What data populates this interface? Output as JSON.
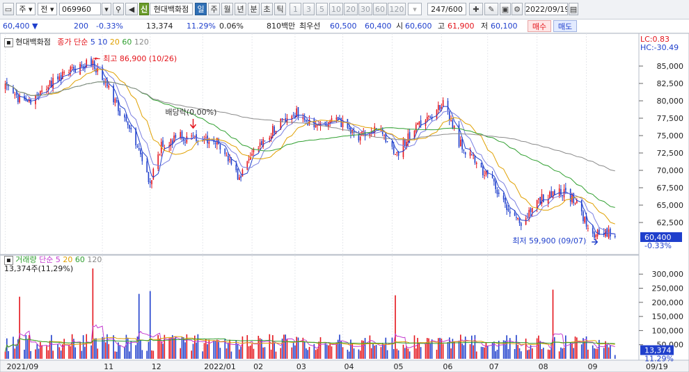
{
  "toolbar": {
    "market": "주",
    "type": "전",
    "code": "069960",
    "badge": "신",
    "name": "현대백화점",
    "periods": [
      "일",
      "주",
      "월",
      "년",
      "분",
      "초",
      "틱"
    ],
    "active_period": "일",
    "minutes": [
      "1",
      "3",
      "5",
      "10",
      "20",
      "30",
      "60",
      "120"
    ],
    "count": "247/600",
    "date": "2022/09/19"
  },
  "info": {
    "price": "60,400",
    "change": "200",
    "change_pct": "-0.33%",
    "volume": "13,374",
    "vol_ratio": "11.29%",
    "turnover": "0.06%",
    "amount": "810백만",
    "quote_label": "최우선",
    "ask": "60,500",
    "bid": "60,400",
    "open_label": "시",
    "open": "60,600",
    "high_label": "고",
    "high": "61,900",
    "low_label": "저",
    "low": "60,100",
    "buy_label": "매수",
    "sell_label": "매도"
  },
  "chart_data": {
    "type": "candlestick",
    "price_pane": {
      "title": "현대백화점",
      "series": [
        {
          "name": "종가 단순",
          "color": "#e4141b"
        },
        {
          "name": "5",
          "color": "#1f3fcc"
        },
        {
          "name": "10",
          "color": "#e0a000"
        },
        {
          "name": "20",
          "color": "#4fb04f"
        },
        {
          "name": "60",
          "color": "#2f9f2f"
        },
        {
          "name": "120",
          "color": "#8a8a8a"
        }
      ],
      "ylim": [
        58500,
        88500
      ],
      "y_ticks": [
        "85,000",
        "82,500",
        "80,000",
        "77,500",
        "75,000",
        "72,500",
        "70,000",
        "67,500",
        "65,000",
        "62,500"
      ],
      "lc_label": "LC:0.83",
      "hc_label": "HC:-30.49",
      "high_annotation": "최고 86,900 (10/26)",
      "low_annotation": "최저 59,900 (09/07)",
      "dividend_annotation": "배당락(0.00%)",
      "last_price": "60,400",
      "last_change": "-0.33%",
      "key_closes": [
        {
          "date": "2021-09-01",
          "close": 81800
        },
        {
          "date": "2021-09-15",
          "close": 79500
        },
        {
          "date": "2021-10-08",
          "close": 84000
        },
        {
          "date": "2021-10-26",
          "close": 85600
        },
        {
          "date": "2021-11-10",
          "close": 79500
        },
        {
          "date": "2021-11-24",
          "close": 73000
        },
        {
          "date": "2021-12-01",
          "close": 68000
        },
        {
          "date": "2021-12-08",
          "close": 73500
        },
        {
          "date": "2021-12-20",
          "close": 74800
        },
        {
          "date": "2021-12-28",
          "close": 74500
        },
        {
          "date": "2022-01-12",
          "close": 74200
        },
        {
          "date": "2022-01-26",
          "close": 69000
        },
        {
          "date": "2022-02-07",
          "close": 73500
        },
        {
          "date": "2022-02-21",
          "close": 77000
        },
        {
          "date": "2022-03-03",
          "close": 78200
        },
        {
          "date": "2022-03-15",
          "close": 76000
        },
        {
          "date": "2022-03-28",
          "close": 77200
        },
        {
          "date": "2022-04-11",
          "close": 75000
        },
        {
          "date": "2022-04-25",
          "close": 76000
        },
        {
          "date": "2022-05-04",
          "close": 72000
        },
        {
          "date": "2022-05-16",
          "close": 76000
        },
        {
          "date": "2022-05-26",
          "close": 77500
        },
        {
          "date": "2022-06-03",
          "close": 80000
        },
        {
          "date": "2022-06-13",
          "close": 74000
        },
        {
          "date": "2022-06-24",
          "close": 71000
        },
        {
          "date": "2022-07-05",
          "close": 68000
        },
        {
          "date": "2022-07-15",
          "close": 64000
        },
        {
          "date": "2022-07-22",
          "close": 62000
        },
        {
          "date": "2022-07-28",
          "close": 64000
        },
        {
          "date": "2022-08-04",
          "close": 66000
        },
        {
          "date": "2022-08-10",
          "close": 66500
        },
        {
          "date": "2022-08-18",
          "close": 67000
        },
        {
          "date": "2022-08-25",
          "close": 65500
        },
        {
          "date": "2022-09-01",
          "close": 62500
        },
        {
          "date": "2022-09-07",
          "close": 60700
        },
        {
          "date": "2022-09-14",
          "close": 61000
        },
        {
          "date": "2022-09-19",
          "close": 60400
        }
      ]
    },
    "volume_pane": {
      "title": "거래량",
      "ma_label": "단순",
      "ma_periods": [
        "5",
        "20",
        "60",
        "120"
      ],
      "current_label": "13,374주(11,29%)",
      "ylim": [
        0,
        340000
      ],
      "y_ticks": [
        "300,000",
        "250,000",
        "200,000",
        "150,000",
        "100,000",
        "50,000"
      ],
      "last_volume": "13,374",
      "last_ratio": "11.29%",
      "spikes": [
        {
          "date": "2021-10-26",
          "volume": 320000
        },
        {
          "date": "2021-12-01",
          "volume": 240000
        },
        {
          "date": "2021-11-24",
          "volume": 230000
        },
        {
          "date": "2021-09-10",
          "volume": 220000
        },
        {
          "date": "2022-05-04",
          "volume": 225000
        },
        {
          "date": "2022-08-11",
          "volume": 245000
        }
      ],
      "typical_volume": 70000
    },
    "x_ticks": [
      {
        "label": "2021/09",
        "date": "2021-09-01"
      },
      {
        "label": "11",
        "date": "2021-11-01"
      },
      {
        "label": "12",
        "date": "2021-12-01"
      },
      {
        "label": "2022/01",
        "date": "2022-01-03"
      },
      {
        "label": "02",
        "date": "2022-02-03"
      },
      {
        "label": "03",
        "date": "2022-03-02"
      },
      {
        "label": "04",
        "date": "2022-04-01"
      },
      {
        "label": "05",
        "date": "2022-05-02"
      },
      {
        "label": "06",
        "date": "2022-06-02"
      },
      {
        "label": "07",
        "date": "2022-07-01"
      },
      {
        "label": "08",
        "date": "2022-08-01"
      },
      {
        "label": "09",
        "date": "2022-09-01"
      }
    ],
    "end_date_label": "09/19",
    "x_range": [
      "2021-08-30",
      "2022-09-20"
    ]
  },
  "colors": {
    "up": "#e4141b",
    "down": "#1f3fcc",
    "accent": "#2f6fb5"
  }
}
